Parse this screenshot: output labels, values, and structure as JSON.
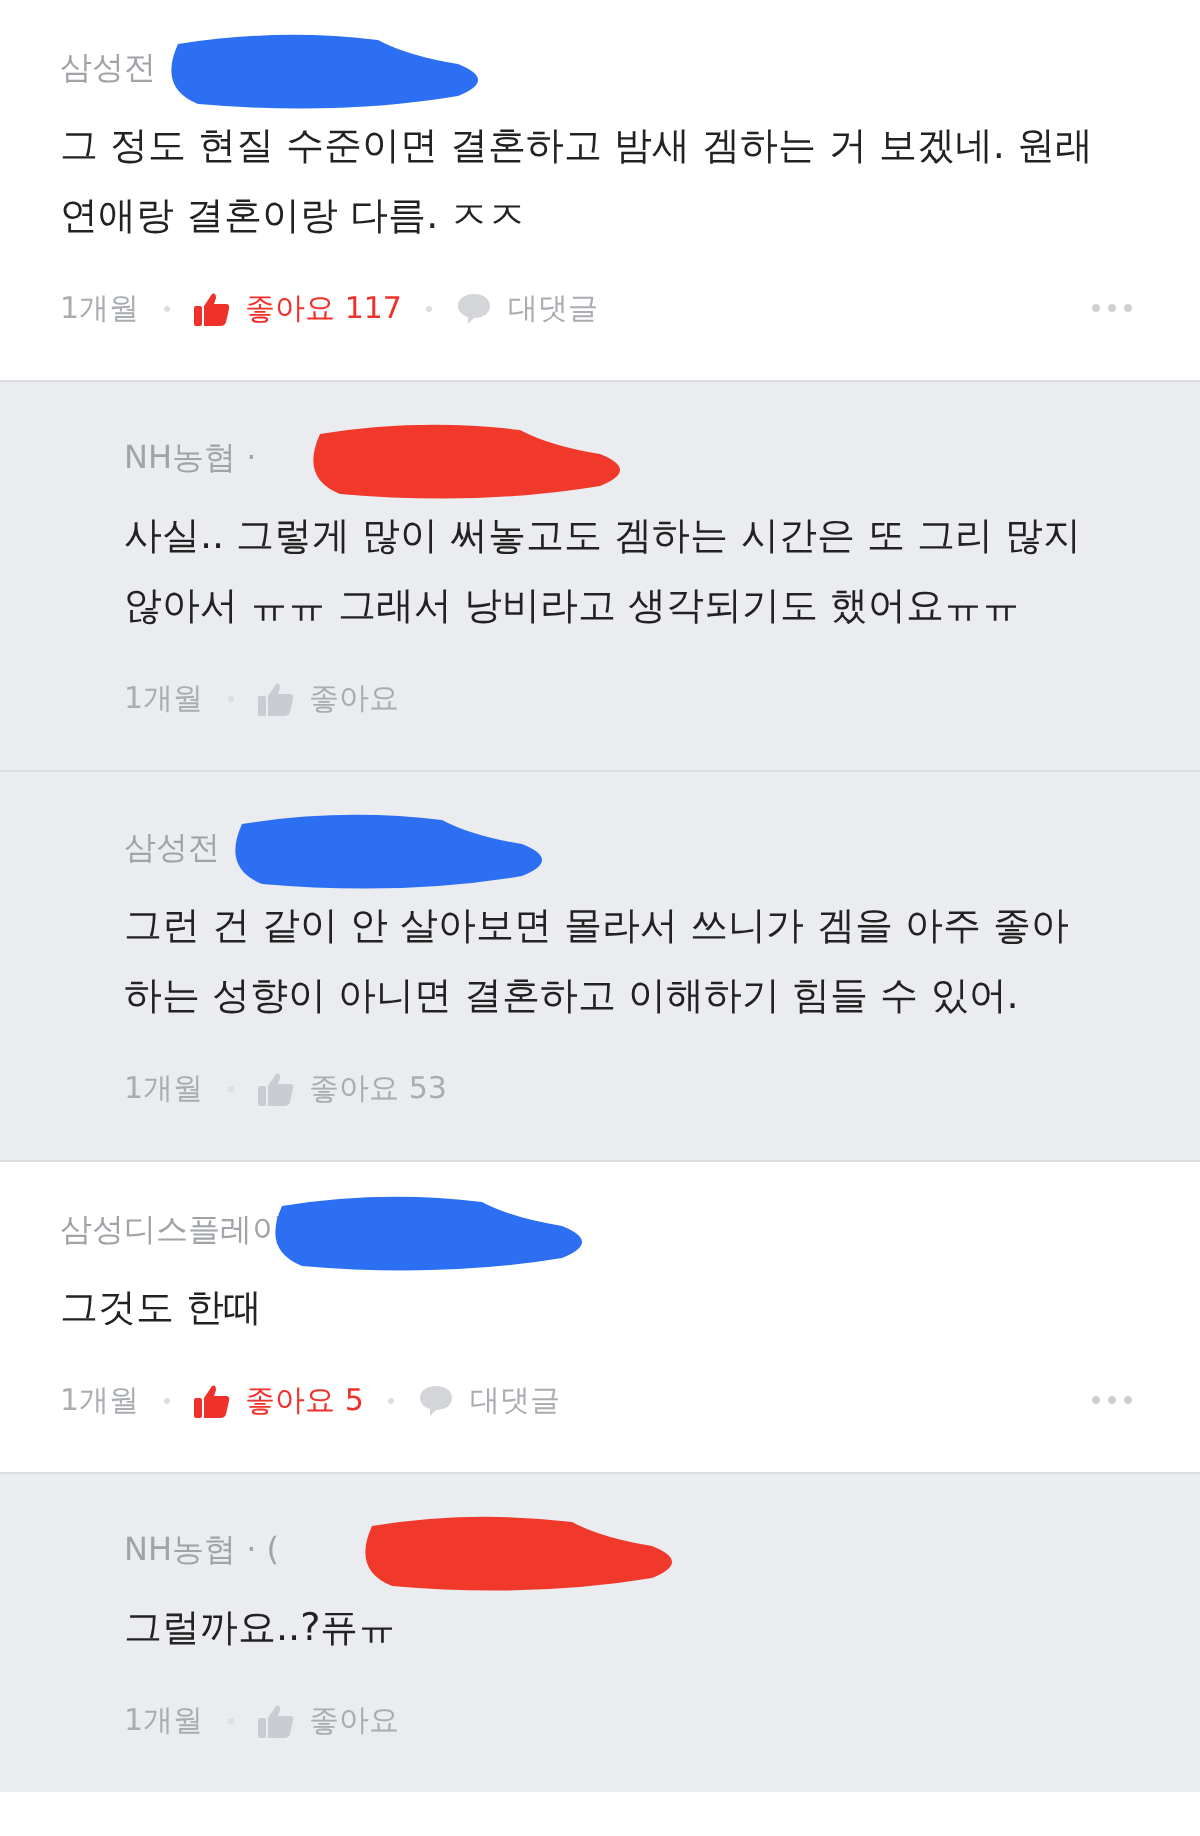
{
  "comments": [
    {
      "kind": "comment",
      "author": "삼성전",
      "scribble": {
        "color": "#2d6ff2"
      },
      "body": [
        "그 정도 현질 수준이면 결혼하고 밤새 겜하는 거 보겠네. 원래",
        "연애랑 결혼이랑 다름. ㅈㅈ"
      ],
      "time": "1개월",
      "like": {
        "label": "좋아요",
        "count": "117",
        "liked": true
      },
      "reply_label": "대댓글"
    },
    {
      "kind": "reply",
      "author": "NH농협 ·",
      "scribble": {
        "color": "#f0392b"
      },
      "body": [
        "사실.. 그렇게 많이 써놓고도 겜하는 시간은 또 그리 많지",
        "않아서 ㅠㅠ 그래서 낭비라고 생각되기도 했어요ㅠㅠ"
      ],
      "time": "1개월",
      "like": {
        "label": "좋아요",
        "liked": false
      }
    },
    {
      "kind": "reply",
      "author": "삼성전",
      "scribble": {
        "color": "#2d6ff2"
      },
      "body": [
        "그런 건 같이 안 살아보면 몰라서 쓰니가 겜을 아주 좋아",
        "하는 성향이 아니면 결혼하고 이해하기 힘들 수 있어."
      ],
      "time": "1개월",
      "like": {
        "label": "좋아요",
        "count": "53",
        "liked": false
      }
    },
    {
      "kind": "comment",
      "author": "삼성디스플레이",
      "scribble": {
        "color": "#2d6ff2"
      },
      "body": [
        "그것도 한때"
      ],
      "time": "1개월",
      "like": {
        "label": "좋아요",
        "count": "5",
        "liked": true
      },
      "reply_label": "대댓글"
    },
    {
      "kind": "reply",
      "author": "NH농협 · (",
      "scribble": {
        "color": "#f0392b"
      },
      "body": [
        "그럴까요..?퓨ㅠ"
      ],
      "time": "1개월",
      "like": {
        "label": "좋아요",
        "liked": false
      }
    }
  ]
}
